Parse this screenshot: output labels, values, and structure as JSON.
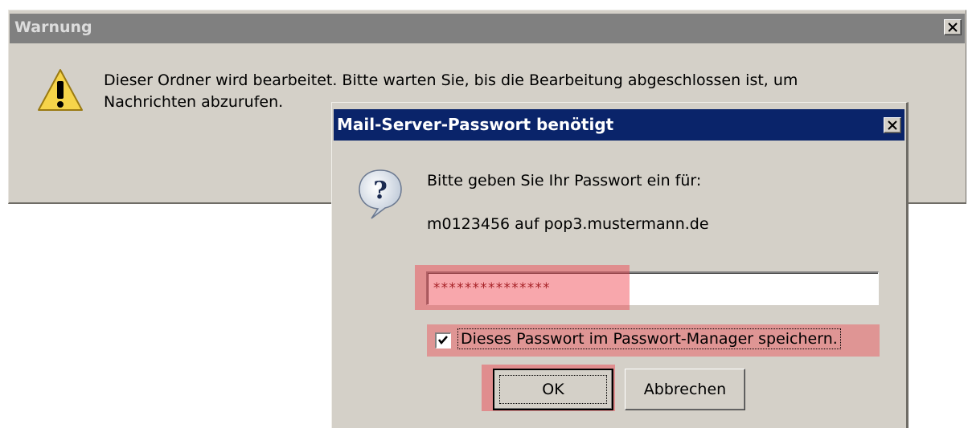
{
  "warning_dialog": {
    "title": "Warnung",
    "message": "Dieser Ordner wird bearbeitet. Bitte warten Sie, bis die Bearbeitung abgeschlossen ist, um Nachrichten abzurufen."
  },
  "password_dialog": {
    "title": "Mail-Server-Passwort benötigt",
    "prompt": "Bitte geben Sie Ihr Passwort ein für:",
    "account": "m0123456 auf pop3.mustermann.de",
    "password_value": "***************",
    "remember_checked": true,
    "remember_label": "Dieses Passwort im Passwort-Manager speichern.",
    "ok_label": "OK",
    "cancel_label": "Abbrechen"
  },
  "highlight_color": "#f03c46"
}
